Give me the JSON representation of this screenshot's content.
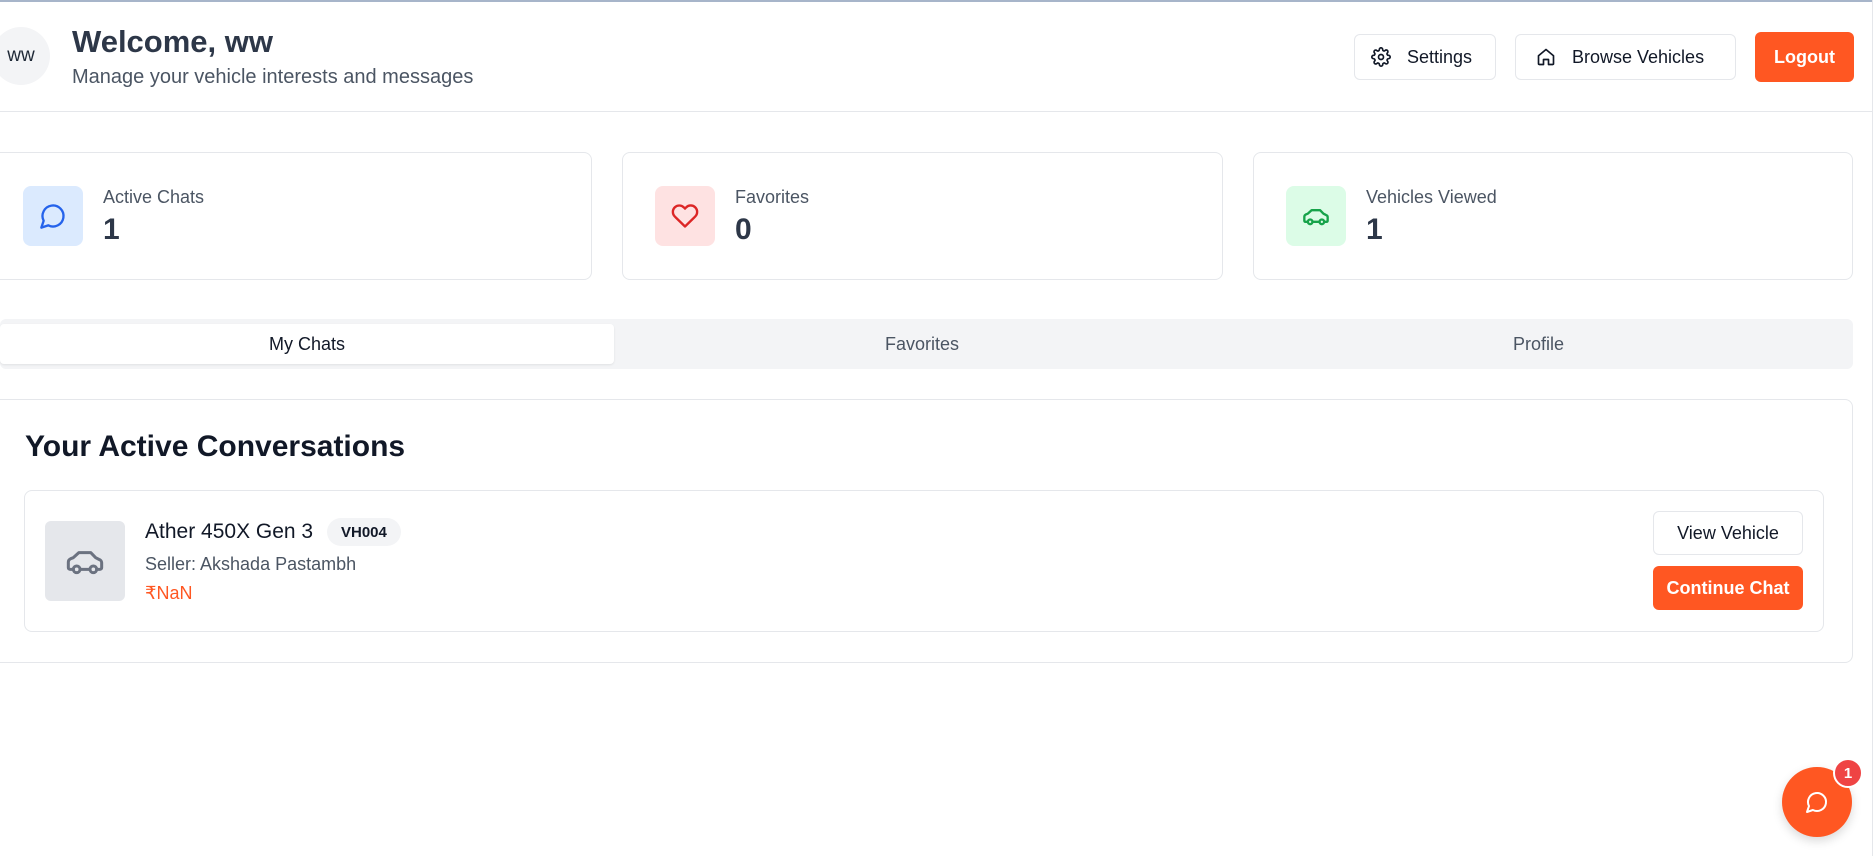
{
  "header": {
    "avatar_initials": "ww",
    "welcome": "Welcome, ww",
    "subtitle": "Manage your vehicle interests and messages",
    "settings_label": "Settings",
    "browse_label": "Browse Vehicles",
    "logout_label": "Logout"
  },
  "stats": [
    {
      "label": "Active Chats",
      "value": "1",
      "icon": "message-icon",
      "color": "#2563eb",
      "bg": "#dbeafe"
    },
    {
      "label": "Favorites",
      "value": "0",
      "icon": "heart-icon",
      "color": "#dc2626",
      "bg": "#fee2e2"
    },
    {
      "label": "Vehicles Viewed",
      "value": "1",
      "icon": "car-icon",
      "color": "#16a34a",
      "bg": "#dcfce7"
    }
  ],
  "tabs": [
    {
      "label": "My Chats",
      "active": true
    },
    {
      "label": "Favorites",
      "active": false
    },
    {
      "label": "Profile",
      "active": false
    }
  ],
  "conversations": {
    "title": "Your Active Conversations",
    "items": [
      {
        "vehicle_name": "Ather 450X Gen 3",
        "vehicle_code": "VH004",
        "seller": "Seller: Akshada Pastambh",
        "price": "₹NaN",
        "view_label": "View Vehicle",
        "continue_label": "Continue Chat"
      }
    ]
  },
  "chat_fab": {
    "badge": "1"
  },
  "colors": {
    "accent": "#ff5722",
    "badge": "#ef4444"
  }
}
